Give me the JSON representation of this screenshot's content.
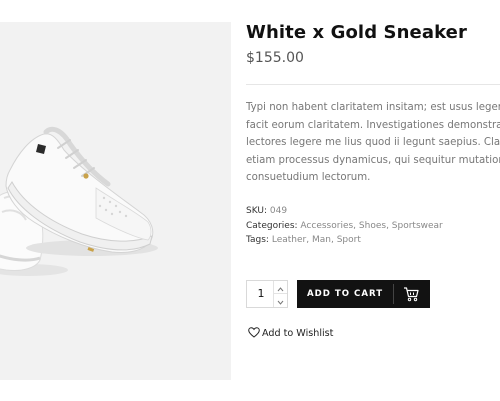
{
  "product": {
    "title": "White x Gold Sneaker",
    "price": "$155.00",
    "description_lines": [
      "Typi non habent claritatem insitam; est usus legentis in iis qui",
      "facit eorum claritatem. Investigationes demonstraverunt",
      "lectores legere me lius quod ii legunt saepius. Claritas est",
      "etiam processus dynamicus, qui sequitur mutationem",
      "consuetudium lectorum."
    ]
  },
  "meta": {
    "sku_label": "SKU:",
    "sku_value": "049",
    "categories_label": "Categories:",
    "categories": [
      "Accessories",
      "Shoes",
      "Sportswear"
    ],
    "tags_label": "Tags:",
    "tags": [
      "Leather",
      "Man",
      "Sport"
    ],
    "separator": ", "
  },
  "cart": {
    "quantity": "1",
    "button_label": "ADD TO CART",
    "icon": "cart-icon"
  },
  "wishlist": {
    "label": "Add to Wishlist",
    "icon": "heart-icon"
  },
  "colors": {
    "gallery_bg": "#f2f2f2",
    "button_bg": "#121212",
    "accent_gold": "#c9a24a"
  }
}
